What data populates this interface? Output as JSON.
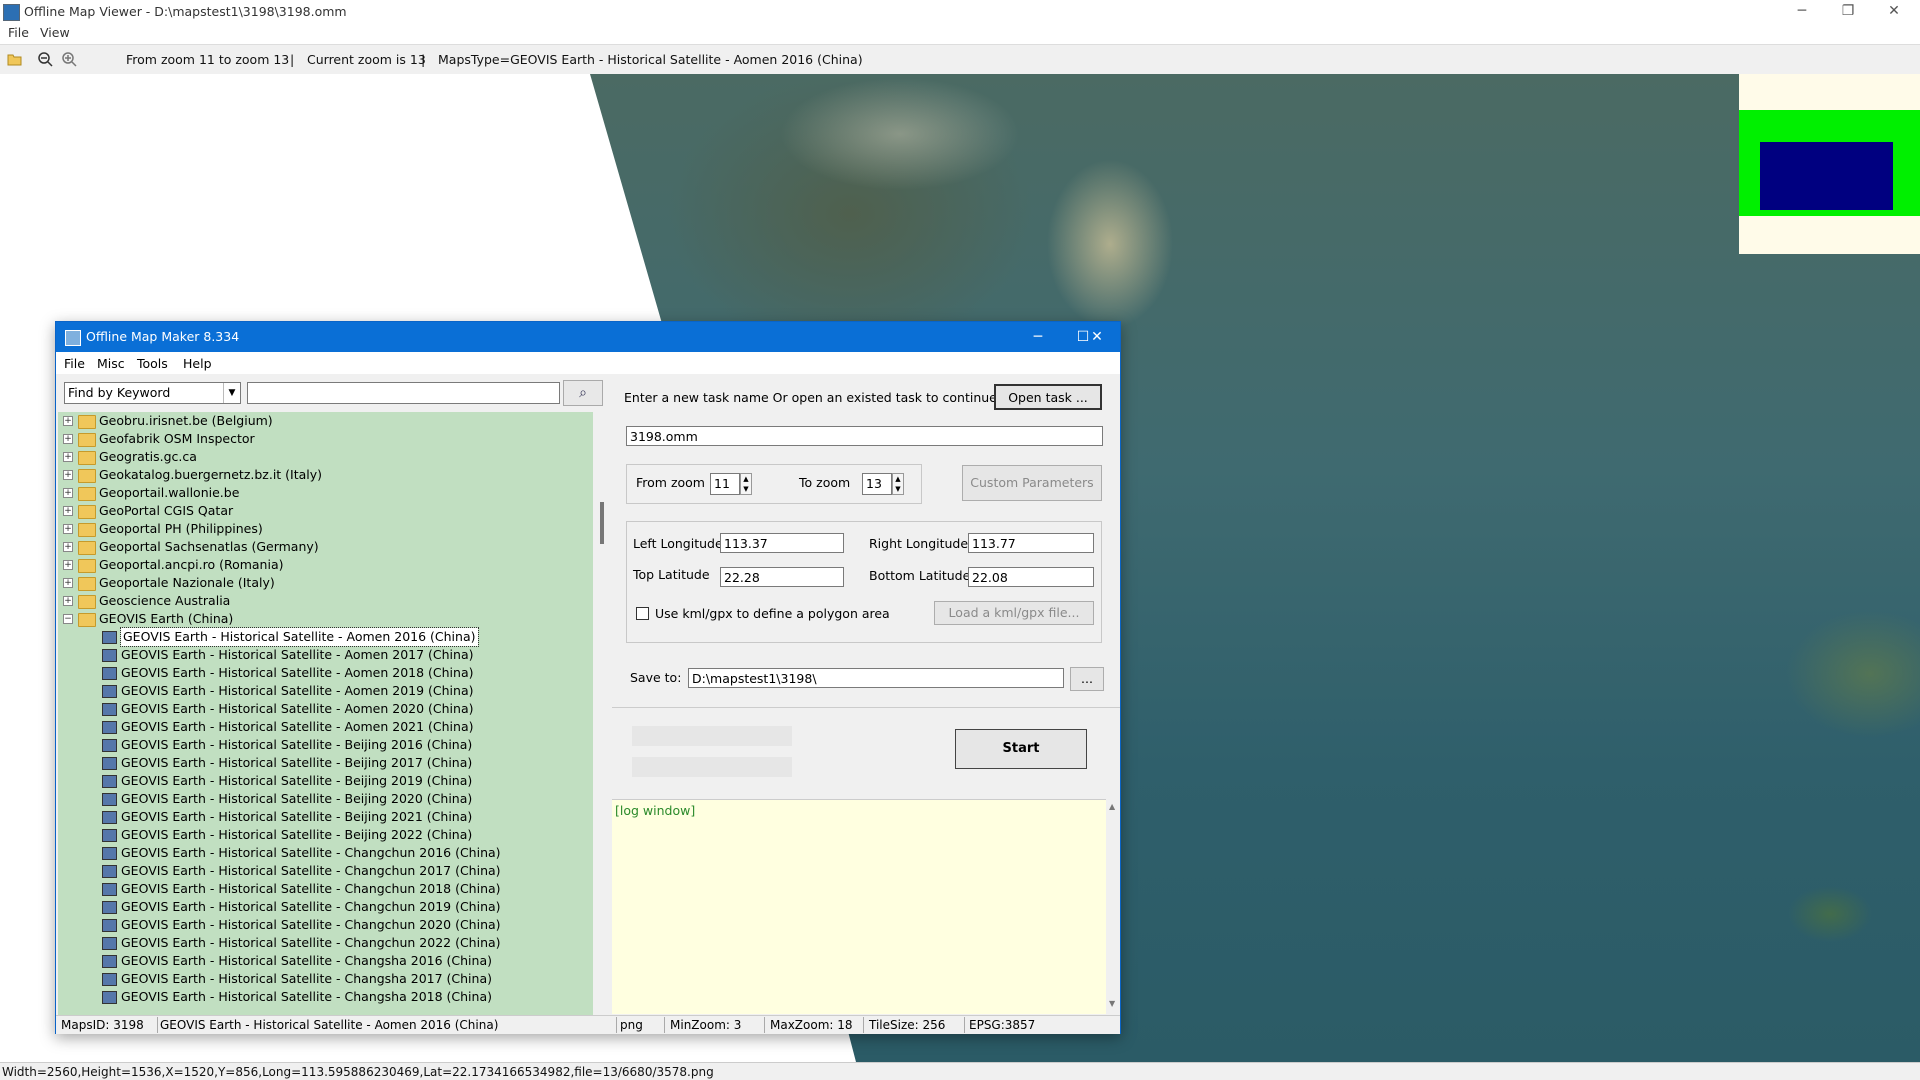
{
  "window": {
    "title": "Offline Map Viewer - D:\\mapstest1\\3198\\3198.omm",
    "minimize": "─",
    "restore": "❐",
    "close": "✕"
  },
  "menu": {
    "file": "File",
    "view": "View"
  },
  "toolbar": {
    "open_icon": "folder-open-icon",
    "zoom_out_icon": "zoom-out-icon",
    "zoom_in_icon": "zoom-in-icon",
    "zoom_range": "From zoom 11 to zoom 13",
    "divider": "|",
    "current_zoom": "Current zoom is 13",
    "divider2": "|",
    "maps_type": "MapsType=GEOVIS Earth - Historical Satellite - Aomen 2016 (China)"
  },
  "status": {
    "text": "Width=2560,Height=1536,X=1520,Y=856,Long=113.595886230469,Lat=22.1734166534982,file=13/6680/3578.png"
  },
  "dialog": {
    "title": "Offline Map Maker 8.334",
    "menu": {
      "file": "File",
      "misc": "Misc",
      "tools": "Tools",
      "help": "Help"
    },
    "find_mode": "Find by Keyword",
    "find_value": "",
    "tree": {
      "folders": [
        "Geobru.irisnet.be (Belgium)",
        "Geofabrik OSM Inspector",
        "Geogratis.gc.ca",
        "Geokatalog.buergernetz.bz.it (Italy)",
        "Geoportail.wallonie.be",
        "GeoPortal CGIS Qatar",
        "Geoportal PH (Philippines)",
        "Geoportal Sachsenatlas (Germany)",
        "Geoportal.ancpi.ro (Romania)",
        "Geoportale Nazionale (Italy)",
        "Geoscience Australia",
        "GEOVIS Earth (China)"
      ],
      "items": [
        "GEOVIS Earth - Historical Satellite - Aomen 2016 (China)",
        "GEOVIS Earth - Historical Satellite - Aomen 2017 (China)",
        "GEOVIS Earth - Historical Satellite - Aomen 2018 (China)",
        "GEOVIS Earth - Historical Satellite - Aomen 2019 (China)",
        "GEOVIS Earth - Historical Satellite - Aomen 2020 (China)",
        "GEOVIS Earth - Historical Satellite - Aomen 2021 (China)",
        "GEOVIS Earth - Historical Satellite - Beijing 2016 (China)",
        "GEOVIS Earth - Historical Satellite - Beijing 2017 (China)",
        "GEOVIS Earth - Historical Satellite - Beijing 2019 (China)",
        "GEOVIS Earth - Historical Satellite - Beijing 2020 (China)",
        "GEOVIS Earth - Historical Satellite - Beijing 2021 (China)",
        "GEOVIS Earth - Historical Satellite - Beijing 2022 (China)",
        "GEOVIS Earth - Historical Satellite - Changchun 2016 (China)",
        "GEOVIS Earth - Historical Satellite - Changchun 2017 (China)",
        "GEOVIS Earth - Historical Satellite - Changchun 2018 (China)",
        "GEOVIS Earth - Historical Satellite - Changchun 2019 (China)",
        "GEOVIS Earth - Historical Satellite - Changchun 2020 (China)",
        "GEOVIS Earth - Historical Satellite - Changchun 2022 (China)",
        "GEOVIS Earth - Historical Satellite - Changsha 2016 (China)",
        "GEOVIS Earth - Historical Satellite - Changsha 2017 (China)",
        "GEOVIS Earth - Historical Satellite - Changsha 2018 (China)"
      ],
      "selected_index": 0
    },
    "task_prompt": "Enter a new task name Or open an existed task to continue:",
    "open_task": "Open task ...",
    "task_name": "3198.omm",
    "from_zoom_label": "From zoom",
    "from_zoom": "11",
    "to_zoom_label": "To zoom",
    "to_zoom": "13",
    "custom_params": "Custom Parameters",
    "left_lon_label": "Left Longitude",
    "left_lon": "113.37",
    "right_lon_label": "Right Longitude",
    "right_lon": "113.77",
    "top_lat_label": "Top Latitude",
    "top_lat": "22.28",
    "bottom_lat_label": "Bottom Latitude",
    "bottom_lat": "22.08",
    "kml_label": "Use kml/gpx to define a polygon area",
    "kml_checked": false,
    "load_kml": "Load a kml/gpx file...",
    "save_label": "Save to:",
    "save_path": "D:\\mapstest1\\3198\\",
    "browse": "...",
    "start": "Start",
    "log_title": "[log window]",
    "status": {
      "maps_id": "MapsID: 3198",
      "maps_name": "GEOVIS Earth - Historical Satellite - Aomen 2016 (China)",
      "format": "png",
      "min_zoom": "MinZoom: 3",
      "max_zoom": "MaxZoom: 18",
      "tile_size": "TileSize: 256",
      "epsg": "EPSG:3857"
    }
  },
  "colors": {
    "tree_bg": "#c1dfc1",
    "title_blue": "#0a6fd6",
    "log_bg": "#ffffe0",
    "mini_green": "#00f000",
    "mini_blue": "#000080"
  }
}
